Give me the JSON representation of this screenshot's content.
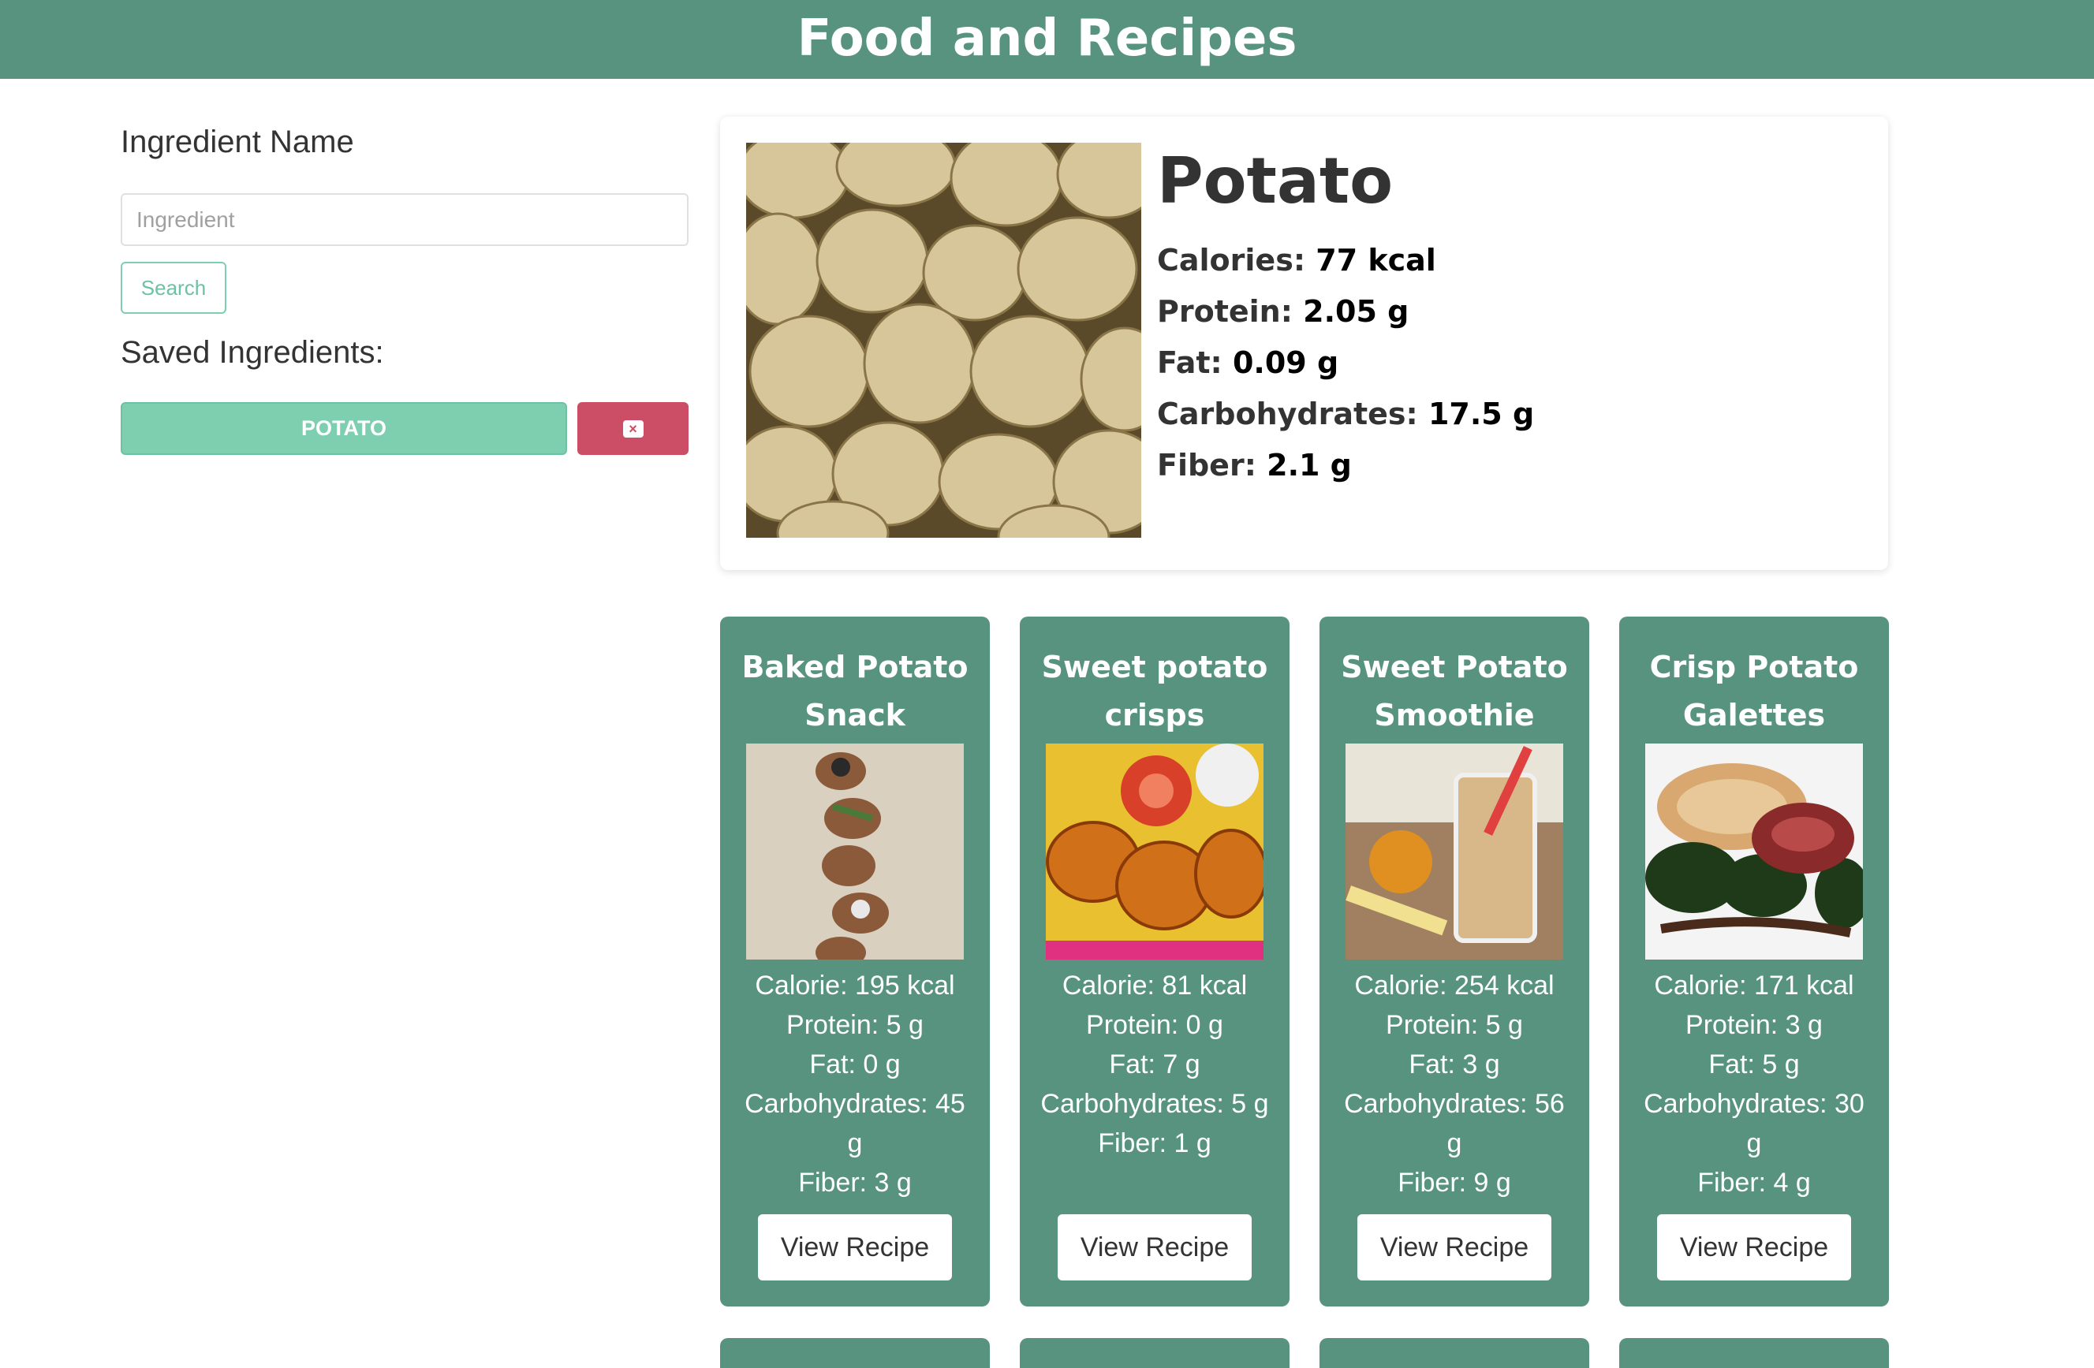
{
  "header": {
    "title": "Food and Recipes"
  },
  "sidebar": {
    "ingredient_label": "Ingredient Name",
    "ingredient_placeholder": "Ingredient",
    "ingredient_value": "",
    "search_label": "Search",
    "saved_label": "Saved Ingredients:",
    "saved_items": [
      {
        "label": "POTATO",
        "delete_icon": "close-icon"
      }
    ]
  },
  "ingredient": {
    "name": "Potato",
    "image_icon": "potato-photo",
    "nutrients": [
      {
        "label": "Calories:",
        "value": "77 kcal"
      },
      {
        "label": "Protein:",
        "value": "2.05 g"
      },
      {
        "label": "Fat:",
        "value": "0.09 g"
      },
      {
        "label": "Carbohydrates:",
        "value": "17.5 g"
      },
      {
        "label": "Fiber:",
        "value": "2.1 g"
      }
    ]
  },
  "recipes": [
    {
      "title": "Baked Potato Snack",
      "calorie": "Calorie: 195 kcal",
      "protein": "Protein: 5 g",
      "fat": "Fat: 0 g",
      "carbs": "Carbohydrates: 45 g",
      "fiber": "Fiber: 3 g",
      "button": "View Recipe"
    },
    {
      "title": "Sweet potato crisps",
      "calorie": "Calorie: 81 kcal",
      "protein": "Protein: 0 g",
      "fat": "Fat: 7 g",
      "carbs": "Carbohydrates: 5 g",
      "fiber": "Fiber: 1 g",
      "button": "View Recipe"
    },
    {
      "title": "Sweet Potato Smoothie",
      "calorie": "Calorie: 254 kcal",
      "protein": "Protein: 5 g",
      "fat": "Fat: 3 g",
      "carbs": "Carbohydrates: 56 g",
      "fiber": "Fiber: 9 g",
      "button": "View Recipe"
    },
    {
      "title": "Crisp Potato Galettes",
      "calorie": "Calorie: 171 kcal",
      "protein": "Protein: 3 g",
      "fat": "Fat: 5 g",
      "carbs": "Carbohydrates: 30 g",
      "fiber": "Fiber: 4 g",
      "button": "View Recipe"
    }
  ],
  "colors": {
    "primary": "#57937e",
    "accent": "#7dcfb0",
    "danger": "#cc4d66"
  }
}
